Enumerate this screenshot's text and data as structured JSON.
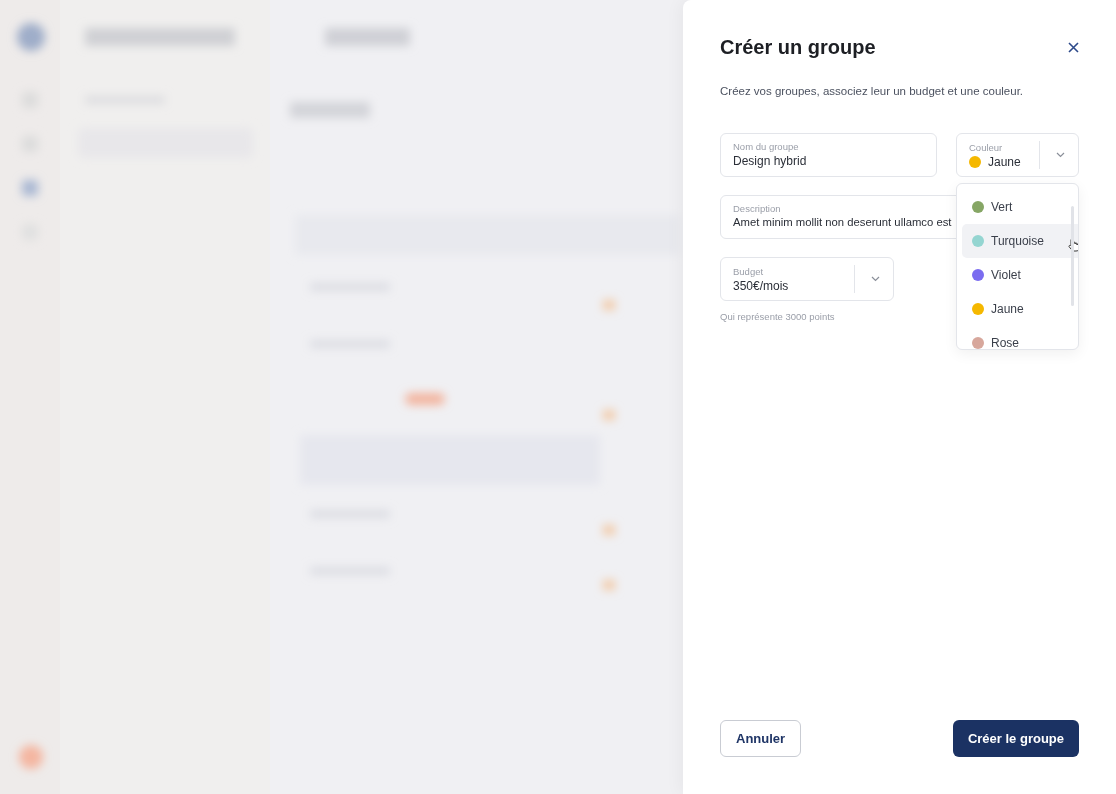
{
  "dialog": {
    "title": "Créer un groupe",
    "subtitle": "Créez vos groupes, associez leur un budget et une couleur.",
    "fields": [
      {
        "kind": "text",
        "label": "Nom du groupe",
        "value": "Design hybrid"
      },
      {
        "kind": "color",
        "label": "Couleur",
        "value": "Jaune",
        "color": "#f5b800"
      },
      {
        "kind": "text",
        "label": "Description",
        "value": "Amet minim mollit non deserunt ullamco est"
      },
      {
        "kind": "select",
        "label": "Budget",
        "value": "350€/mois",
        "hint": "Qui représente 3000 points"
      }
    ],
    "color_options": [
      {
        "label": "Vert",
        "color": "#86a665",
        "highlighted": false
      },
      {
        "label": "Turquoise",
        "color": "#94d5d1",
        "highlighted": true
      },
      {
        "label": "Violet",
        "color": "#7b6cf0",
        "highlighted": false
      },
      {
        "label": "Jaune",
        "color": "#f5b800",
        "highlighted": false
      },
      {
        "label": "Rose",
        "color": "#d7a79c",
        "highlighted": false
      }
    ],
    "buttons": [
      {
        "kind": "secondary",
        "label": "Annuler"
      },
      {
        "kind": "primary",
        "label": "Créer le groupe"
      }
    ]
  }
}
